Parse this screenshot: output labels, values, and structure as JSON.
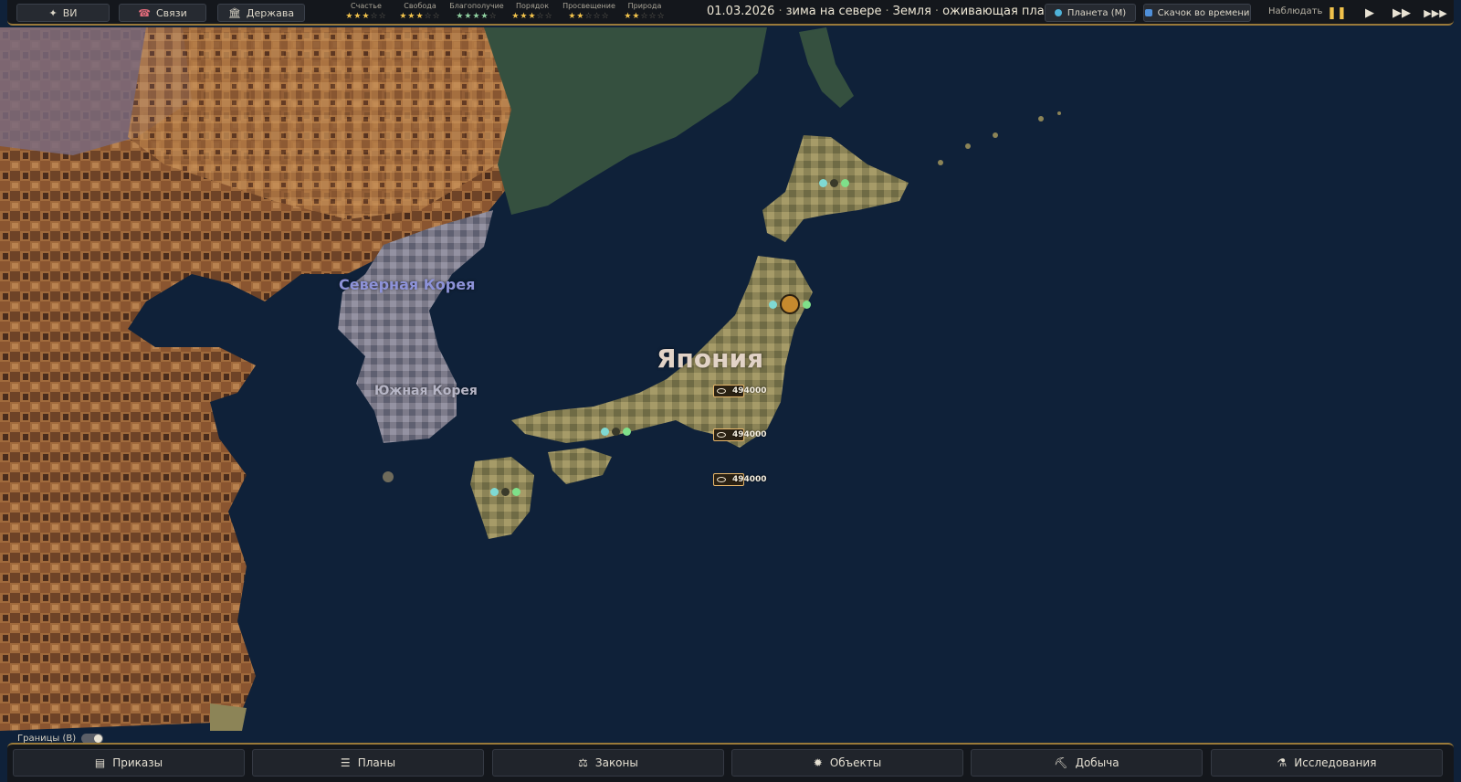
{
  "topbar": {
    "buttons": [
      {
        "icon": "sparkle-icon",
        "glyph": "✦",
        "label": "ВИ"
      },
      {
        "icon": "handshake-icon",
        "glyph": "☎",
        "label": "Связи"
      },
      {
        "icon": "government-building-icon",
        "glyph": "🏛",
        "label": "Держава"
      }
    ],
    "stats": [
      {
        "label": "Счастье",
        "stars": "★★★",
        "empty": "☆☆"
      },
      {
        "label": "Свобода",
        "stars": "★★★",
        "empty": "☆☆"
      },
      {
        "label": "Благополучие",
        "stars": "★★★★",
        "empty": "☆"
      },
      {
        "label": "Порядок",
        "stars": "★★★",
        "empty": "☆☆"
      },
      {
        "label": "Просвещение",
        "stars": "★★",
        "empty": "☆☆☆"
      },
      {
        "label": "Природа",
        "stars": "★★",
        "empty": "☆☆☆"
      }
    ],
    "date": "01.03.2026",
    "season": "зима на севере",
    "planet": "Земля",
    "planet_status": "оживающая планета",
    "planet_button": "Планета (M)",
    "timejump_button": "Скачок во времени",
    "observe": "Наблюдать"
  },
  "map": {
    "labels": {
      "north_korea": "Северная Корея",
      "south_korea": "Южная Корея",
      "japan": "Япония"
    },
    "markers": [
      "494000",
      "494000",
      "494000"
    ]
  },
  "bottom": {
    "borders_toggle": "Границы (B)",
    "tabs": [
      {
        "icon": "orders-icon",
        "glyph": "▤",
        "label": "Приказы"
      },
      {
        "icon": "plans-icon",
        "glyph": "☰",
        "label": "Планы"
      },
      {
        "icon": "laws-icon",
        "glyph": "⚖",
        "label": "Законы"
      },
      {
        "icon": "objects-icon",
        "glyph": "✹",
        "label": "Объекты"
      },
      {
        "icon": "mining-icon",
        "glyph": "⛏",
        "label": "Добыча"
      },
      {
        "icon": "research-icon",
        "glyph": "⚗",
        "label": "Исследования"
      }
    ]
  },
  "colors": {
    "ocean": "#0f2139",
    "accent_gold": "#9a7a3a",
    "north_korea_label": "#8d92d8",
    "japan_label": "#e2d3c7"
  }
}
